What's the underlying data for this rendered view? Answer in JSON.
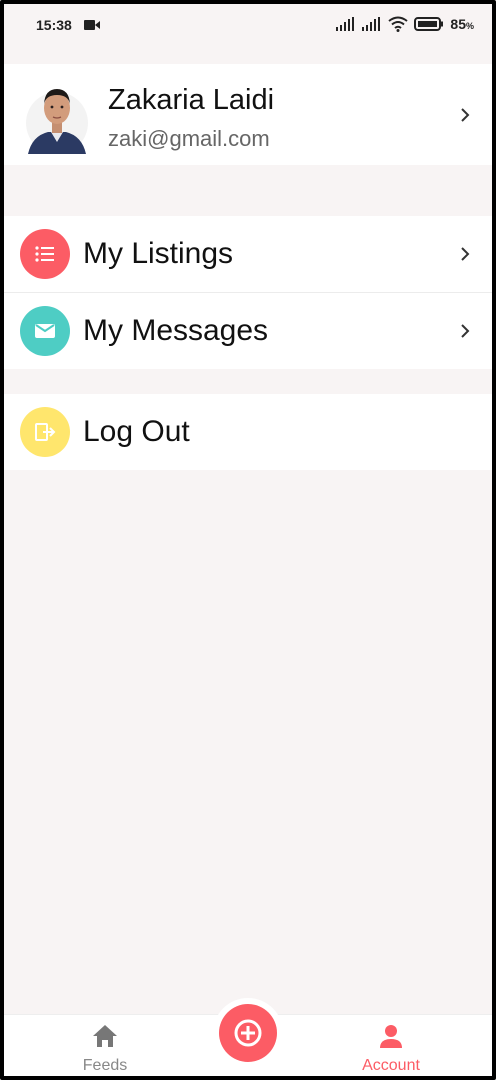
{
  "status_bar": {
    "time": "15:38",
    "battery": "85",
    "battery_unit": "%"
  },
  "profile": {
    "name": "Zakaria Laidi",
    "email": "zaki@gmail.com",
    "avatar_icon": "user-photo"
  },
  "menu": [
    {
      "label": "My Listings",
      "icon": "list-icon",
      "color": "#fc5c65"
    },
    {
      "label": "My Messages",
      "icon": "email-icon",
      "color": "#4ecdc4"
    }
  ],
  "logout": {
    "label": "Log Out",
    "icon": "logout-icon",
    "color": "#ffe66d"
  },
  "bottom_nav": {
    "feeds": "Feeds",
    "account": "Account",
    "active": "Account",
    "accent": "#fc5c65"
  }
}
